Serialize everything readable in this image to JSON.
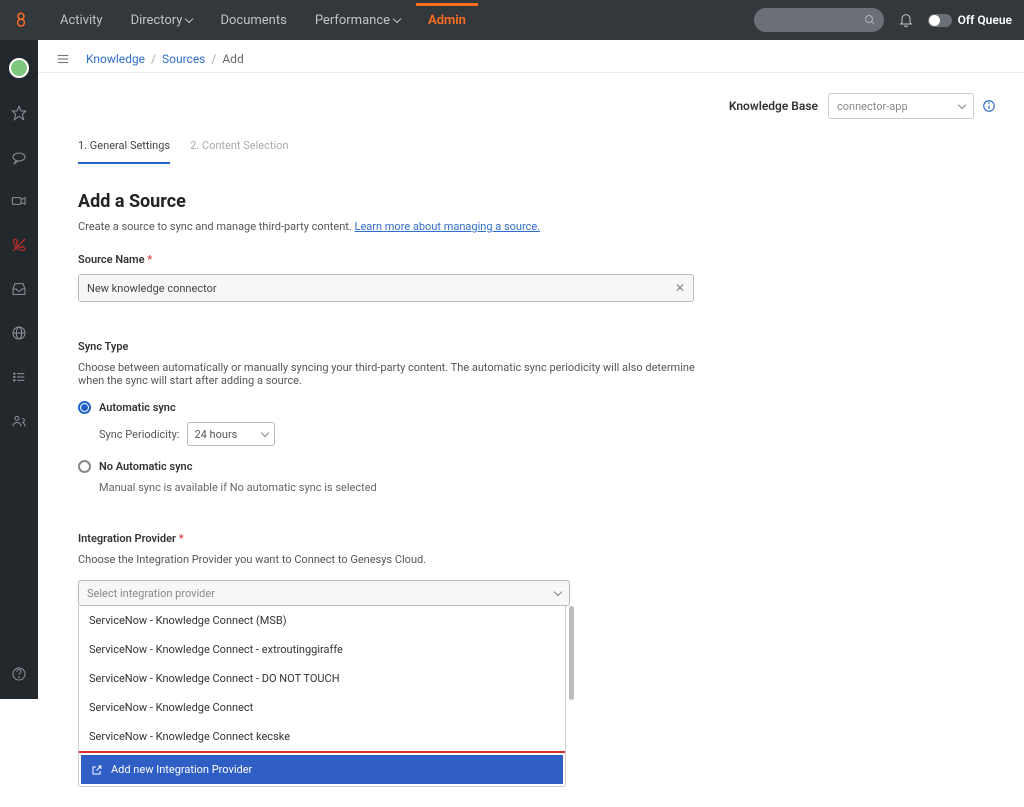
{
  "topnav": {
    "items": [
      "Activity",
      "Directory",
      "Documents",
      "Performance",
      "Admin"
    ],
    "offqueue": "Off Queue"
  },
  "breadcrumb": {
    "knowledge": "Knowledge",
    "sources": "Sources",
    "add": "Add"
  },
  "kb": {
    "label": "Knowledge Base",
    "selected": "connector-app"
  },
  "tabs": {
    "general": "1. General Settings",
    "content": "2. Content Selection"
  },
  "page": {
    "title": "Add a Source",
    "desc_text": "Create a source to sync and manage third-party content. ",
    "desc_link": "Learn more about managing a source."
  },
  "source_name": {
    "label": "Source Name",
    "value": "New knowledge connector"
  },
  "sync": {
    "label": "Sync Type",
    "help": "Choose between automatically or manually syncing your third-party content. The automatic sync periodicity will also determine when the sync will start after adding a source.",
    "auto_label": "Automatic sync",
    "periodicity_label": "Sync Periodicity:",
    "periodicity_value": "24 hours",
    "noauto_label": "No Automatic sync",
    "noauto_desc": "Manual sync is available if No automatic sync is selected"
  },
  "provider": {
    "label": "Integration Provider",
    "help": "Choose the Integration Provider you want to Connect to Genesys Cloud.",
    "placeholder": "Select integration provider",
    "options": [
      "ServiceNow - Knowledge Connect (MSB)",
      "ServiceNow - Knowledge Connect - extroutinggiraffe",
      "ServiceNow - Knowledge Connect - DO NOT TOUCH",
      "ServiceNow - Knowledge Connect",
      "ServiceNow - Knowledge Connect kecske"
    ],
    "add_new": "Add new Integration Provider"
  }
}
